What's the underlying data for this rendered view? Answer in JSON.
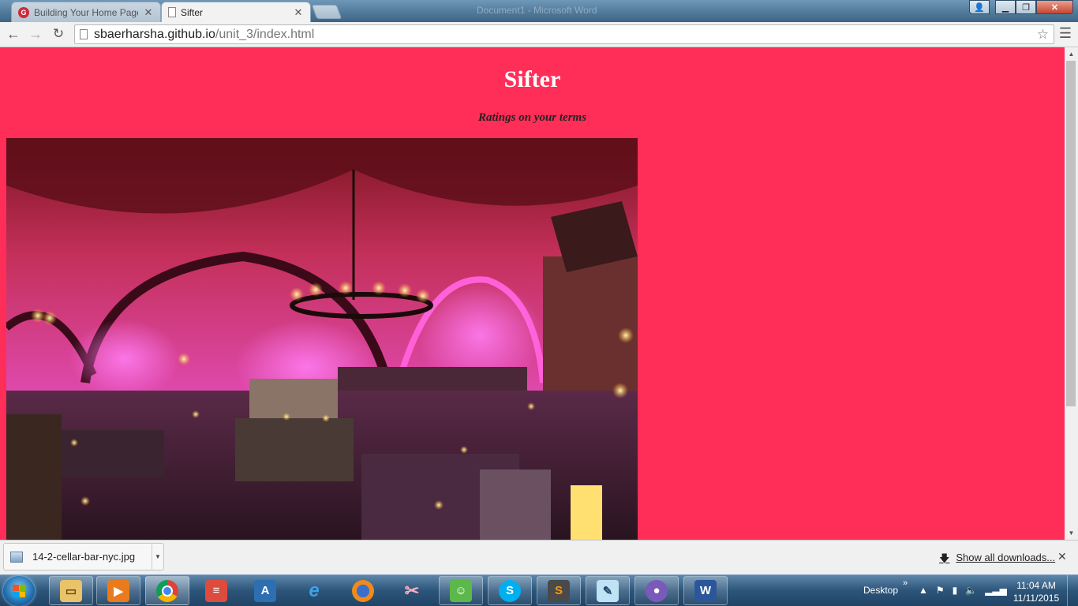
{
  "browser": {
    "tabs": [
      {
        "title": "Building Your Home Page",
        "active": false
      },
      {
        "title": "Sifter",
        "active": true
      }
    ],
    "ghost_window_title": "Document1 - Microsoft Word",
    "url_host": "sbaerharsha.github.io",
    "url_path": "/unit_3/index.html"
  },
  "page": {
    "heading": "Sifter",
    "tagline": "Ratings on your terms",
    "background_color": "#ff2e58"
  },
  "downloads": {
    "file_name": "14-2-cellar-bar-nyc.jpg",
    "show_all_label": "Show all downloads..."
  },
  "taskbar": {
    "apps": [
      "windows-explorer",
      "media-player",
      "chrome",
      "todoist",
      "text-editor",
      "internet-explorer",
      "firefox",
      "snipping-tool",
      "live-messenger",
      "skype",
      "sublime-text",
      "notepad",
      "github",
      "word"
    ],
    "desktop_label": "Desktop",
    "time": "11:04 AM",
    "date": "11/11/2015"
  }
}
